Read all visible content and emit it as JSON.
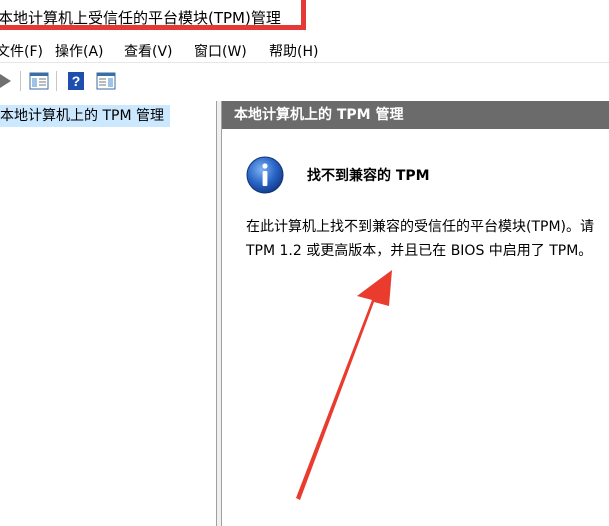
{
  "window": {
    "title": "本地计算机上受信任的平台模块(TPM)管理"
  },
  "menubar": {
    "items": [
      {
        "label": "文件(F)"
      },
      {
        "label": "操作(A)"
      },
      {
        "label": "查看(V)"
      },
      {
        "label": "窗口(W)"
      },
      {
        "label": "帮助(H)"
      }
    ]
  },
  "toolbar": {
    "icons": [
      "forward-icon",
      "show-hide-console-tree-icon",
      "help-icon",
      "show-hide-action-pane-icon"
    ]
  },
  "tree": {
    "selected_item": "本地计算机上的 TPM 管理"
  },
  "main": {
    "header": "本地计算机上的 TPM 管理",
    "message_title": "找不到兼容的 TPM",
    "message_line1": "在此计算机上找不到兼容的受信任的平台模块(TPM)。请",
    "message_line2": "TPM 1.2 或更高版本，并且已在 BIOS 中启用了 TPM。",
    "icon": "info-icon"
  },
  "colors": {
    "annotation": "#e53935",
    "header_bg": "#6b6b6b",
    "selection_bg": "#cce8ff",
    "info_blue": "#1f5fbf"
  }
}
